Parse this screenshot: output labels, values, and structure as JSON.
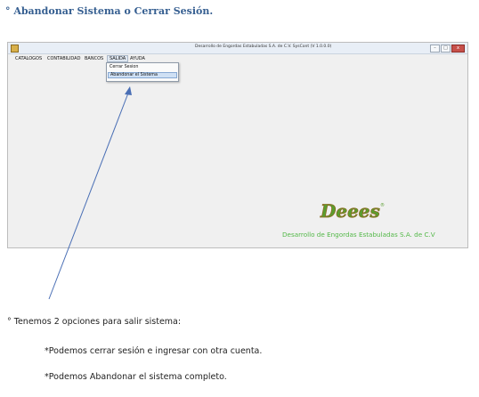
{
  "heading": "° Abandonar Sistema o Cerrar Sesión.",
  "window": {
    "title": "Desarrollo de Engordas Estabuladas S.A. de C.V.          SysCont (V 1.0.0.0)",
    "buttons": {
      "minimize": "–",
      "maximize": "□",
      "close": "x"
    }
  },
  "menu": {
    "items": [
      "CATALOGOS",
      "CONTABILIDAD",
      "BANCOS",
      "SALIDA",
      "AYUDA"
    ],
    "active": "SALIDA",
    "dropdown": [
      "Cerrar Sesion",
      "Abandonar el Sistema"
    ],
    "selected": "Abandonar el Sistema"
  },
  "brand": {
    "logo_text": "Deees",
    "caption": "Desarrollo de Engordas Estabuladas S.A. de C.V",
    "logo_color": "#5a9e2f",
    "caption_color": "#53b848"
  },
  "body": {
    "intro": "° Tenemos 2 opciones para salir sistema:",
    "option1": "*Podemos cerrar sesión e ingresar con otra cuenta.",
    "option2": "*Podemos Abandonar el sistema completo."
  },
  "colors": {
    "heading": "#365f91",
    "arrow": "#4a6fb5"
  }
}
